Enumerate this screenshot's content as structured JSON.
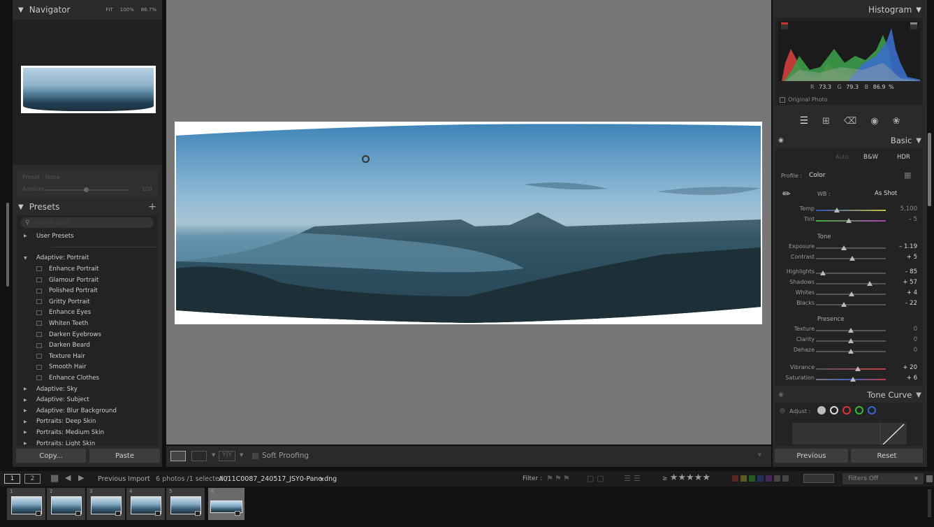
{
  "navigator": {
    "title": "Navigator",
    "zoom_fit": "FIT",
    "zoom_100": "100%",
    "zoom_other": "86.7%"
  },
  "preset_amount": {
    "preset_label": "Preset : None",
    "amount_label": "Amount",
    "amount_value": "100"
  },
  "presets": {
    "title": "Presets",
    "search_placeholder": "Filter Presets",
    "groups": [
      {
        "label": "User Presets",
        "expanded": false
      },
      {
        "label": "Adaptive: Portrait",
        "expanded": true,
        "items": [
          "Enhance Portrait",
          "Glamour Portrait",
          "Polished Portrait",
          "Gritty Portrait",
          "Enhance Eyes",
          "Whiten Teeth",
          "Darken Eyebrows",
          "Darken Beard",
          "Texture Hair",
          "Smooth Hair",
          "Enhance Clothes"
        ]
      },
      {
        "label": "Adaptive: Sky",
        "expanded": false
      },
      {
        "label": "Adaptive: Subject",
        "expanded": false
      },
      {
        "label": "Adaptive: Blur Background",
        "expanded": false
      },
      {
        "label": "Portraits: Deep Skin",
        "expanded": false
      },
      {
        "label": "Portraits: Medium Skin",
        "expanded": false
      },
      {
        "label": "Portraits: Light Skin",
        "expanded": false
      }
    ]
  },
  "left_buttons": {
    "copy": "Copy...",
    "paste": "Paste"
  },
  "toolbar": {
    "soft_proofing": "Soft Proofing"
  },
  "histogram": {
    "title": "Histogram",
    "r_label": "R",
    "r": "73.3",
    "g_label": "G",
    "g": "79.3",
    "b_label": "B",
    "b": "86.9",
    "pct": "%",
    "original_photo": "Original Photo"
  },
  "basic": {
    "title": "Basic",
    "treatment": {
      "auto": "Auto",
      "bw": "B&W",
      "hdr": "HDR"
    },
    "profile_label": "Profile :",
    "profile_value": "Color",
    "wb_label": "WB :",
    "wb_value": "As Shot",
    "tone_label": "Tone",
    "presence_label": "Presence",
    "sliders": [
      {
        "label": "Temp",
        "value": "5,100",
        "pos": 0.3
      },
      {
        "label": "Tint",
        "value": "– 5",
        "pos": 0.47
      },
      {
        "label": "Exposure",
        "value": "– 1.19",
        "pos": 0.4
      },
      {
        "label": "Contrast",
        "value": "+ 5",
        "pos": 0.52
      },
      {
        "label": "Highlights",
        "value": "– 85",
        "pos": 0.1
      },
      {
        "label": "Shadows",
        "value": "+ 57",
        "pos": 0.77
      },
      {
        "label": "Whites",
        "value": "+ 4",
        "pos": 0.51
      },
      {
        "label": "Blacks",
        "value": "– 22",
        "pos": 0.4
      },
      {
        "label": "Texture",
        "value": "0",
        "pos": 0.5
      },
      {
        "label": "Clarity",
        "value": "0",
        "pos": 0.5
      },
      {
        "label": "Dehaze",
        "value": "0",
        "pos": 0.5
      },
      {
        "label": "Vibrance",
        "value": "+ 20",
        "pos": 0.6
      },
      {
        "label": "Saturation",
        "value": "+ 6",
        "pos": 0.53
      }
    ]
  },
  "tone_curve": {
    "title": "Tone Curve",
    "adjust_label": "Adjust :"
  },
  "right_buttons": {
    "previous": "Previous",
    "reset": "Reset"
  },
  "filmstrip": {
    "view1": "1",
    "view2": "2",
    "source": "Previous Import",
    "count": "6 photos /1 selected /",
    "filename": "A011C0087_240517_JSY0-Pano.dng",
    "filter_label": "Filter :",
    "filters_off": "Filters Off",
    "thumbs": [
      "1",
      "2",
      "3",
      "4",
      "5",
      "6"
    ]
  }
}
